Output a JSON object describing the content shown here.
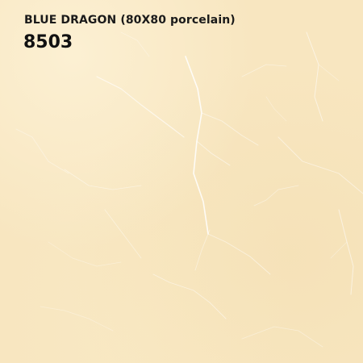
{
  "product": {
    "title": "BLUE DRAGON (80X80 porcelain)",
    "code": "8503"
  },
  "tile": {
    "base_color": "#f8e6c0",
    "vein_color": "#ffffff"
  }
}
